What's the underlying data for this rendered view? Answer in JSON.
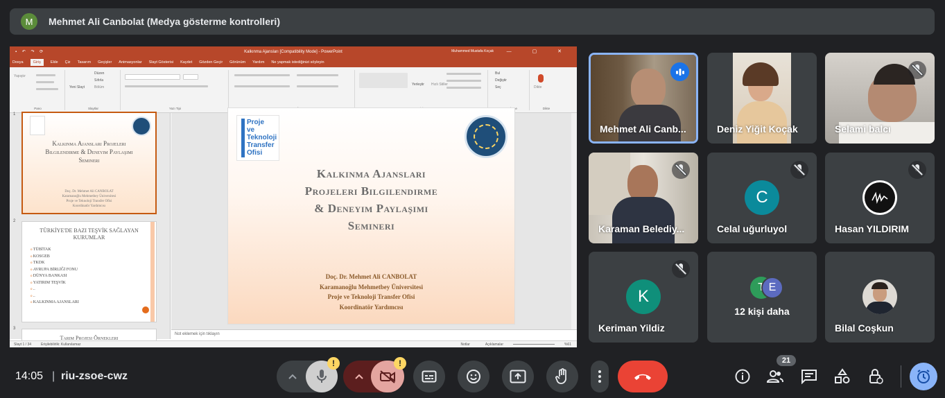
{
  "top_bar": {
    "avatar_letter": "M",
    "title": "Mehmet Ali Canbolat (Medya gösterme kontrolleri)"
  },
  "presentation": {
    "window_title": "Kalkınma Ajansları [Compatibility Mode] - PowerPoint",
    "user": "Muhammed Mustafa Koçak",
    "tabs": [
      "Dosya",
      "Giriş",
      "Ekle",
      "Çiz",
      "Tasarım",
      "Geçişler",
      "Animasyonlar",
      "Slayt Gösterisi",
      "Kaydet",
      "Gözden Geçir",
      "Görünüm",
      "Yardım",
      "Ne yapmak istediğinizi söyleyin"
    ],
    "ribbon_groups": [
      "Pano",
      "Slaytlar",
      "Yazı Tipi",
      "Paragraf",
      "Çizim",
      "Düzenleme",
      "Dikte"
    ],
    "ribbon_labels": {
      "paste": "Yapıştır",
      "new_slide": "Yeni Slayt",
      "layout": "Düzen",
      "reset": "Sıfırla",
      "section": "Bölüm",
      "arrange": "Yerleştir",
      "quick_styles": "Hızlı Stiller",
      "find": "Bul",
      "replace": "Değiştir",
      "select": "Seç",
      "dictate": "Dikte"
    },
    "slide1_thumb": {
      "number": "1",
      "title": "Kalkınma Ajansları Projeleri Bilgilendirme & Deneyim Paylaşımı Semineri",
      "sub": [
        "Doç. Dr. Mehmet Ali CANBOLAT",
        "Karamanoğlu Mehmetbey Üniversitesi",
        "Proje ve Teknoloji Transfer Ofisi",
        "Koordinatör Yardımcısı"
      ]
    },
    "slide2_thumb": {
      "number": "2",
      "title": "TÜRKİYE'DE BAZI TEŞVİK SAĞLAYAN KURUMLAR",
      "items": [
        "TÜBİTAK",
        "KOSGEB",
        "TKDK",
        "AVRUPA BİRLİĞİ FONU",
        "DÜNYA BANKASI",
        "YATIRIM TEŞVİK",
        "..",
        "..",
        "KALKINMA AJANSLARI"
      ]
    },
    "slide3_thumb": {
      "number": "3",
      "title": "Tarım Projesi Örnekleri"
    },
    "slide": {
      "title_lines": [
        "Kalkınma Ajansları",
        "Projeleri Bilgilendirme",
        "& Deneyim Paylaşımı",
        "Semineri"
      ],
      "author_lines": [
        "Doç. Dr. Mehmet Ali CANBOLAT",
        "Karamanoğlu Mehmetbey Üniversitesi",
        "Proje ve Teknoloji Transfer Ofisi",
        "Koordinatör Yardımcısı"
      ],
      "logo_left_lines": [
        "Proje",
        "ve",
        "Teknoloji",
        "Transfer",
        "Ofisi"
      ]
    },
    "notes_placeholder": "Not eklemek için tıklayın",
    "status": {
      "slide_count": "Slayt 1 / 34",
      "accessibility": "Erişilebilirlik: Kullanılamaz",
      "notes": "Notlar",
      "comments": "Açıklamalar",
      "zoom": "%61"
    }
  },
  "participants": [
    {
      "name": "Mehmet Ali Canb...",
      "state": "speaking"
    },
    {
      "name": "Deniz Yiğit Koçak",
      "state": "video"
    },
    {
      "name": "Selami balcı",
      "state": "muted"
    },
    {
      "name": "Karaman Belediy...",
      "state": "muted"
    },
    {
      "name": "Celal uğurluyol",
      "initial": "C",
      "color": "#0b8a9b",
      "state": "muted"
    },
    {
      "name": "Hasan YILDIRIM",
      "state": "muted"
    },
    {
      "name": "Keriman Yildiz",
      "initial": "K",
      "color": "#0f8f7a",
      "state": "muted"
    },
    {
      "name": "12 kişi daha",
      "initials": [
        "T",
        "E"
      ],
      "colors": [
        "#2e9c5a",
        "#5c6bc0"
      ]
    },
    {
      "name": "Bilal Coşkun",
      "state": "avatar"
    }
  ],
  "bottom_bar": {
    "time": "14:05",
    "separator": "|",
    "meeting_code": "riu-zsoe-cwz",
    "warn_symbol": "!",
    "people_count": "21"
  },
  "colors": {
    "background": "#202124",
    "tile": "#3c4043",
    "end_call": "#ea4335",
    "mic_button": "#cfcfcf",
    "cam_off": "#5c1e1e",
    "cam_active": "#e4a5a0",
    "speaking_ring": "#8ab4f8",
    "timer_button": "#8ab4f8",
    "ppt_red": "#b7472a"
  },
  "icons": [
    "microphone-icon",
    "camera-off-icon",
    "captions-icon",
    "emoji-icon",
    "present-icon",
    "raise-hand-icon",
    "more-icon",
    "end-call-icon",
    "info-icon",
    "people-icon",
    "chat-icon",
    "activities-icon",
    "host-controls-icon",
    "timer-icon"
  ]
}
